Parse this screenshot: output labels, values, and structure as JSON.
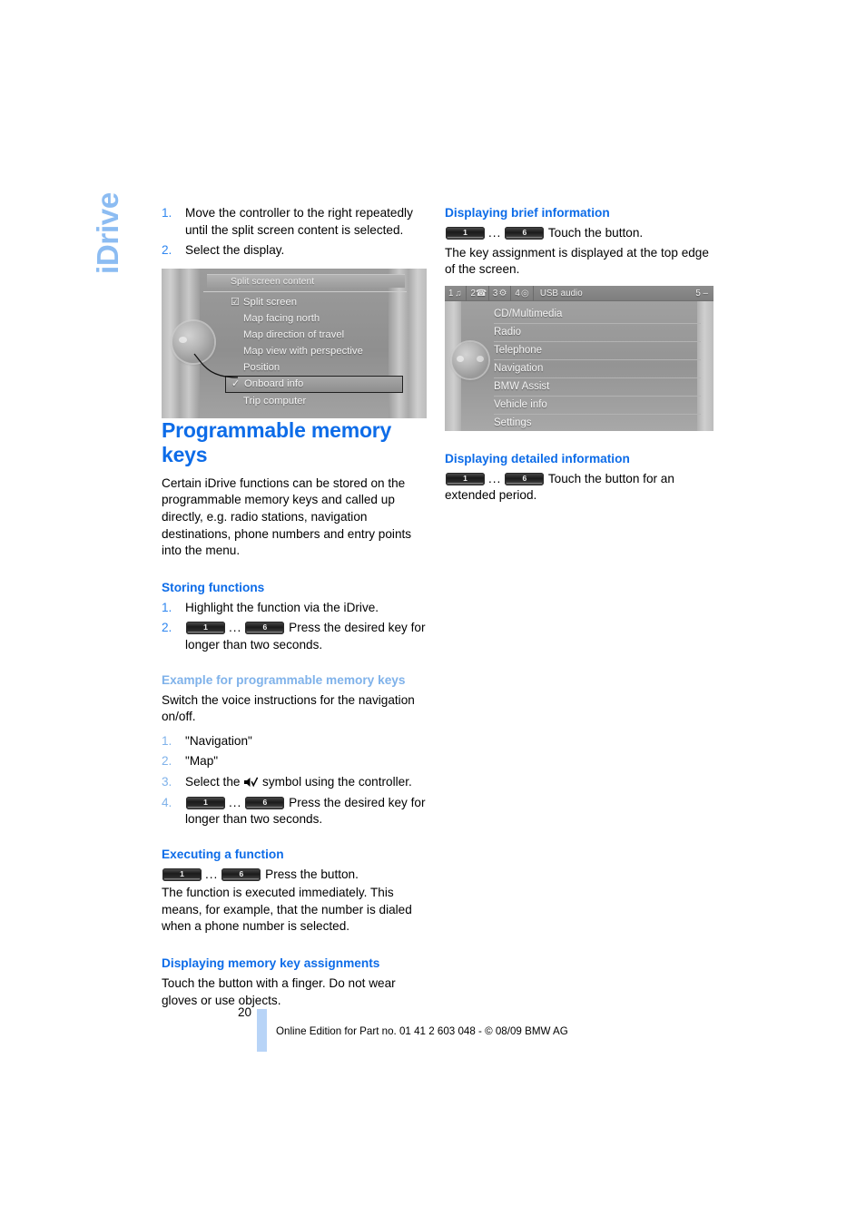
{
  "chapter_tab": "iDrive",
  "left_column": {
    "intro_steps": [
      {
        "num": "1.",
        "text": "Move the controller to the right repeatedly until the split screen content is selected."
      },
      {
        "num": "2.",
        "text": "Select the display."
      }
    ],
    "screenshot_split": {
      "title": "Split screen content",
      "items": [
        {
          "label": "Split screen",
          "check": "☑",
          "selected": false
        },
        {
          "label": "Map facing north",
          "check": "",
          "selected": false
        },
        {
          "label": "Map direction of travel",
          "check": "",
          "selected": false
        },
        {
          "label": "Map view with perspective",
          "check": "",
          "selected": false
        },
        {
          "label": "Position",
          "check": "",
          "selected": false
        },
        {
          "label": "Onboard info",
          "check": "✓",
          "selected": true
        },
        {
          "label": "Trip computer",
          "check": "",
          "selected": false
        }
      ]
    },
    "section_title": "Programmable memory keys",
    "section_body": "Certain iDrive functions can be stored on the programmable memory keys and called up directly, e.g. radio stations, navigation destinations, phone numbers and entry points into the menu.",
    "storing": {
      "heading": "Storing functions",
      "steps": [
        {
          "num": "1.",
          "text": "Highlight the function via the iDrive."
        },
        {
          "num": "2.",
          "key_from": "1",
          "key_to": "6",
          "ellipsis": "...",
          "text": "Press the desired key for longer than two seconds."
        }
      ]
    },
    "example": {
      "heading": "Example for programmable memory keys",
      "body": "Switch the voice instructions for the navigation on/off.",
      "steps": [
        {
          "num": "1.",
          "text": "\"Navigation\""
        },
        {
          "num": "2.",
          "text": "\"Map\""
        },
        {
          "num": "3.",
          "text_before": "Select the",
          "symbol": "speaker-check-icon",
          "text_after": "symbol using the controller."
        },
        {
          "num": "4.",
          "key_from": "1",
          "key_to": "6",
          "ellipsis": "...",
          "text": "Press the desired key for longer than two seconds."
        }
      ]
    },
    "executing": {
      "heading": "Executing a function",
      "key_from": "1",
      "key_to": "6",
      "ellipsis": "...",
      "key_line_text": "Press the button.",
      "body": "The function is executed immediately. This means, for example, that the number is dialed when a phone number is selected."
    },
    "displaying_assignments": {
      "heading": "Displaying memory key assignments",
      "body": "Touch the button with a finger. Do not wear gloves or use objects."
    }
  },
  "right_column": {
    "brief": {
      "heading": "Displaying brief information",
      "key_from": "1",
      "key_to": "6",
      "ellipsis": "...",
      "key_line_text": "Touch the button.",
      "body": "The key assignment is displayed at the top edge of the screen."
    },
    "screenshot_main": {
      "tabs": [
        {
          "num": "1",
          "glyph": "♫"
        },
        {
          "num": "2",
          "glyph": "☎"
        },
        {
          "num": "3",
          "glyph": "⚙"
        },
        {
          "num": "4",
          "glyph": "◎"
        }
      ],
      "source_label": "USB audio",
      "right_label": "5 –",
      "menu": [
        "CD/Multimedia",
        "Radio",
        "Telephone",
        "Navigation",
        "BMW Assist",
        "Vehicle info",
        "Settings"
      ]
    },
    "detailed": {
      "heading": "Displaying detailed information",
      "key_from": "1",
      "key_to": "6",
      "ellipsis": "...",
      "key_line_text": "Touch the button for an extended period."
    }
  },
  "footer": {
    "page_number": "20",
    "note": "Online Edition for Part no. 01 41 2 603 048 - © 08/09 BMW AG"
  }
}
